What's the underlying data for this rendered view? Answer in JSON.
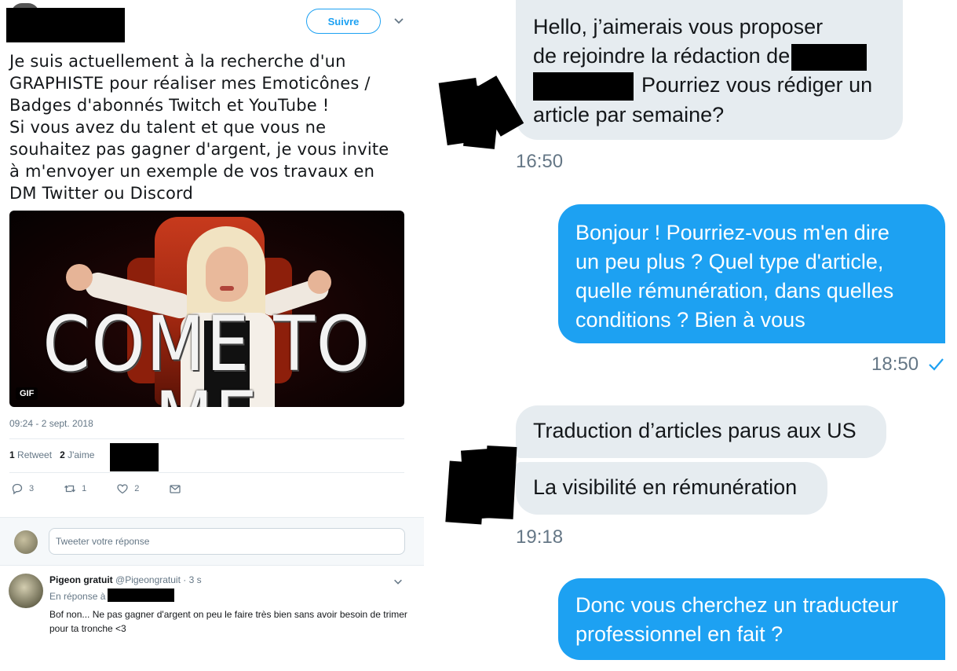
{
  "tweet": {
    "follow_label": "Suivre",
    "text_lines": [
      "Je suis actuellement à la recherche d'un",
      "GRAPHISTE pour réaliser mes Emoticônes /",
      "Badges d'abonnés Twitch et YouTube !",
      "Si vous avez du talent et que vous ne",
      "souhaitez pas gagner d'argent, je vous invite",
      "à m'envoyer un exemple de vos travaux en",
      "DM Twitter ou Discord"
    ],
    "media": {
      "caption": "COME TO ME",
      "badge": "GIF"
    },
    "timestamp": "09:24 - 2 sept. 2018",
    "stats": {
      "retweets_count": "1",
      "retweets_label": "Retweet",
      "likes_count": "2",
      "likes_label": "J'aime"
    },
    "actions": {
      "reply_count": "3",
      "retweet_count": "1",
      "like_count": "2"
    },
    "reply_placeholder": "Tweeter votre réponse"
  },
  "comment": {
    "name": "Pigeon gratuit",
    "handle": "@Pigeongratuit",
    "time": "· 3 s",
    "in_reply_to": "En réponse à",
    "text": "Bof non... Ne pas gagner d'argent on peu le faire très bien sans avoir besoin de trimer pour ta tronche <3"
  },
  "dm": {
    "messages": [
      {
        "dir": "received",
        "lines": [
          "Hello, j’aimerais vous proposer",
          "de rejoindre la rédaction de",
          "Pourriez vous rédiger un",
          "article par semaine?"
        ],
        "time": "16:50"
      },
      {
        "dir": "sent",
        "lines": [
          "Bonjour ! Pourriez-vous m'en dire",
          "un peu plus ? Quel type d'article,",
          "quelle rémunération, dans quelles",
          "conditions ? Bien à vous"
        ],
        "time": "18:50"
      },
      {
        "dir": "received",
        "lines": [
          "Traduction d’articles parus aux US"
        ]
      },
      {
        "dir": "received",
        "lines": [
          "La visibilité en rémunération"
        ],
        "time": "19:18"
      },
      {
        "dir": "sent",
        "lines": [
          "Donc vous cherchez un traducteur",
          "professionnel en fait ?"
        ]
      }
    ]
  },
  "colors": {
    "accent": "#1da1f2",
    "received_bubble": "#e6ecf0",
    "muted_text": "#657786"
  }
}
